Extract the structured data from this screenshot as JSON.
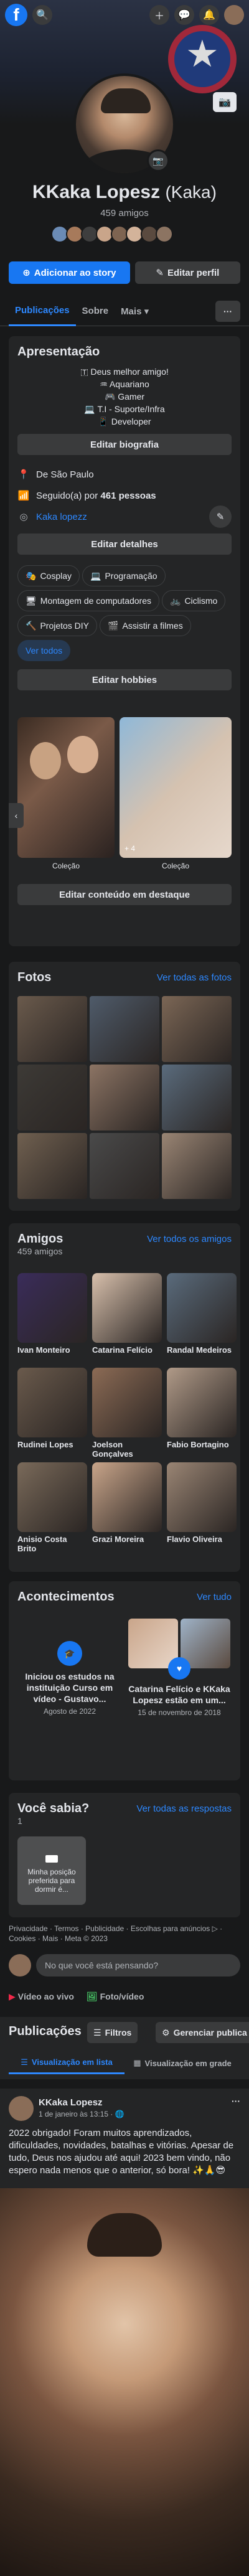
{
  "topbar": {
    "logo": "f",
    "icons": [
      "search-icon",
      "plus-icon",
      "messenger-icon",
      "bell-icon"
    ]
  },
  "profile": {
    "name": "KKaka Lopesz",
    "alt_name": "(Kaka)",
    "friends_count": "459 amigos"
  },
  "actions": {
    "add_story": "Adicionar ao story",
    "edit_profile": "Editar perfil"
  },
  "tabs": [
    {
      "label": "Publicações"
    },
    {
      "label": "Sobre"
    },
    {
      "label": "Mais ▾"
    }
  ],
  "intro": {
    "title": "Apresentação",
    "bio": [
      "🇹 Deus melhor amigo!",
      "♒ Aquariano",
      "🎮 Gamer",
      "💻 T.I - Suporte/Infra",
      "📱 Developer"
    ],
    "edit_bio": "Editar biografia",
    "location": "De São Paulo",
    "followers_prefix": "Seguido(a) por ",
    "followers_count": "461 pessoas",
    "instagram": "Kaka lopezz",
    "edit_details": "Editar detalhes",
    "hobbies": [
      "Cosplay",
      "Programação",
      "Montagem de computadores",
      "Ciclismo",
      "Projetos DIY",
      "Assistir a filmes"
    ],
    "see_all": "Ver todos",
    "edit_hobbies": "Editar hobbies",
    "featured_labels": [
      "Coleção",
      "Coleção"
    ],
    "featured_count": "+ 4",
    "edit_featured": "Editar conteúdo em destaque"
  },
  "photos": {
    "title": "Fotos",
    "see_all": "Ver todas as fotos"
  },
  "friends": {
    "title": "Amigos",
    "count": "459 amigos",
    "see_all": "Ver todos os amigos",
    "list": [
      "Ivan Monteiro",
      "Catarina Felício",
      "Randal Medeiros",
      "Rudinei Lopes",
      "Joelson Gonçalves",
      "Fabio Bortagino",
      "Anisio Costa Brito",
      "Grazi Moreira",
      "Flavio Oliveira"
    ]
  },
  "events": {
    "title": "Acontecimentos",
    "see_all": "Ver tudo",
    "items": [
      {
        "text": "Iniciou os estudos na instituição Curso em vídeo - Gustavo...",
        "date": "Agosto de 2022"
      },
      {
        "text": "Catarina Felício e KKaka Lopesz estão em um...",
        "date": "15 de novembro de 2018"
      }
    ]
  },
  "quiz": {
    "title": "Você sabia?",
    "count": "1",
    "see_all": "Ver todas as respostas",
    "card": "Minha posição preferida para dormir é..."
  },
  "footer": {
    "line1": "Privacidade · Termos · Publicidade · Escolhas para anúncios ▷ ·",
    "line2": "Cookies · Mais · Meta © 2023"
  },
  "composer": {
    "placeholder": "No que você está pensando?",
    "live": "Vídeo ao vivo",
    "photo": "Foto/vídeo"
  },
  "posts_header": {
    "title": "Publicações",
    "filters": "Filtros",
    "manage": "Gerenciar publica",
    "list_view": "Visualização em lista",
    "grid_view": "Visualização em grade"
  },
  "post": {
    "author": "KKaka Lopesz",
    "date": "1 de janeiro às 13:15 · 🌐",
    "text": "2022 obrigado! Foram muitos aprendizados, dificuldades, novidades, batalhas e vitórias. Apesar de tudo, Deus nos ajudou até aqui! 2023 bem vindo, não espero nada menos que o anterior, só bora! ✨🙏😎"
  },
  "colors": {
    "accent": "#2d88ff",
    "brand": "#1877f2",
    "bg": "#18191a",
    "card": "#242526"
  }
}
